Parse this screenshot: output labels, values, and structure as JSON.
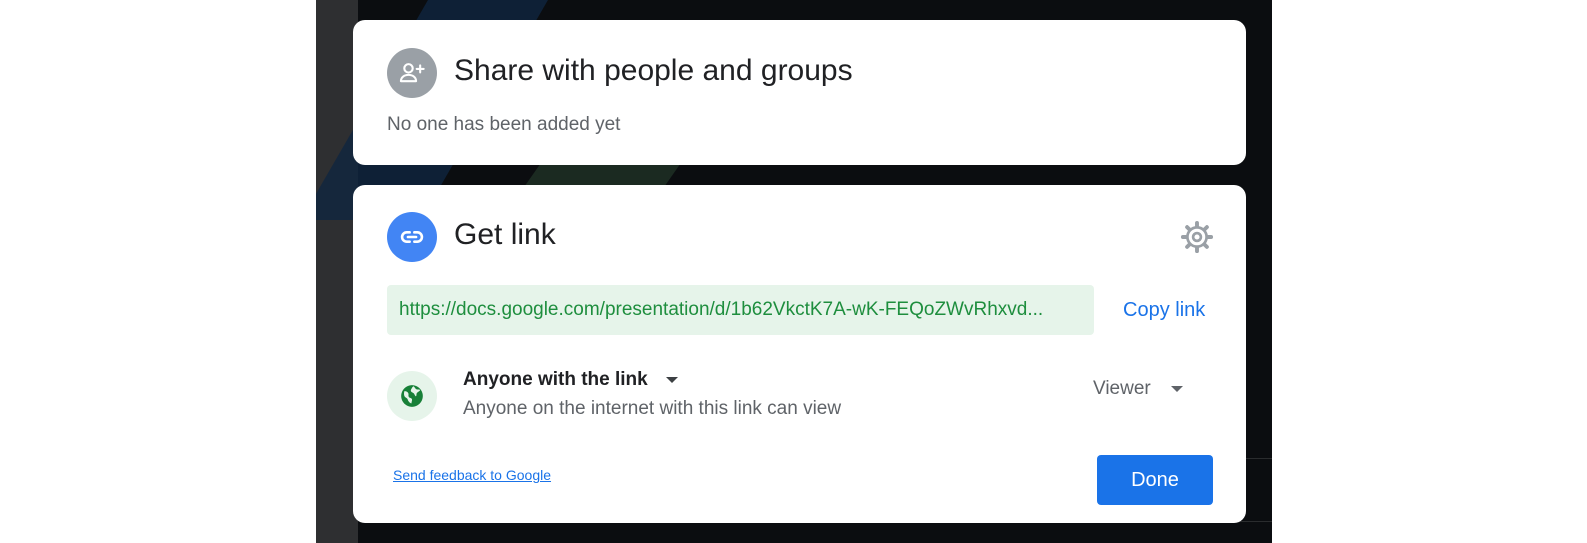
{
  "share_section": {
    "title": "Share with people and groups",
    "empty_message": "No one has been added yet",
    "icon": "person-add-icon"
  },
  "link_section": {
    "title": "Get link",
    "icon": "link-icon",
    "settings_icon": "gear-icon",
    "url": "https://docs.google.com/presentation/d/1b62VkctK7A-wK-FEQoZWvRhxvd...",
    "copy_label": "Copy link",
    "access": {
      "icon": "globe-icon",
      "label": "Anyone with the link",
      "description": "Anyone on the internet with this link can view"
    },
    "role": {
      "label": "Viewer"
    }
  },
  "footer": {
    "feedback_link": "Send feedback to Google",
    "done_label": "Done"
  },
  "colors": {
    "accent_blue": "#1a73e8",
    "link_icon_blue": "#4285f4",
    "url_green": "#1e8e3e",
    "url_bg": "#e6f4ea",
    "muted_icon": "#9aa0a6"
  }
}
